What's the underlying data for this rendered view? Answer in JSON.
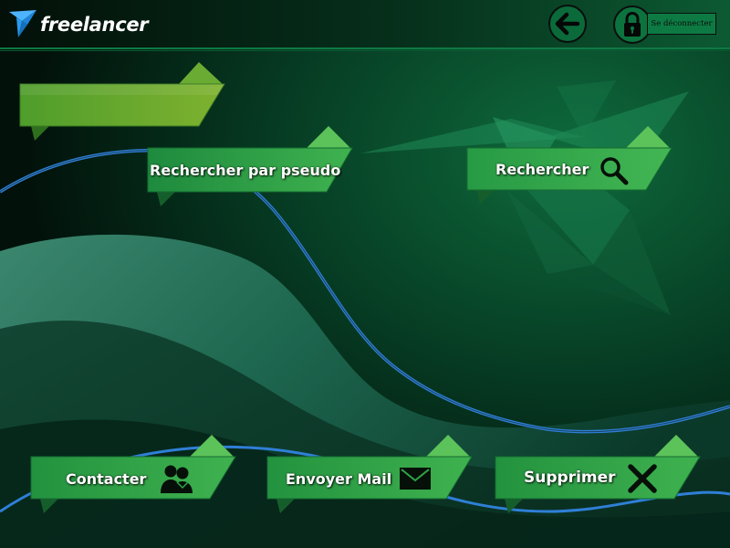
{
  "app": {
    "logo_text": "freelancer"
  },
  "header": {
    "back_icon": "arrow-left-icon",
    "lock_icon": "lock-icon",
    "logout_label": "Se déconnecter"
  },
  "banner": {
    "label": ""
  },
  "actions": {
    "search_pseudo_label": "Rechercher par pseudo",
    "search_label": "Rechercher",
    "search_icon": "magnifier-icon",
    "contact_label": "Contacter",
    "contact_icon": "users-icon",
    "mail_label": "Envoyer Mail",
    "mail_icon": "envelope-icon",
    "delete_label": "Supprimer",
    "delete_icon": "x-icon"
  },
  "colors": {
    "ribbon_green": "#2fa548",
    "ribbon_light": "#5cc35a",
    "banner_green": "#6aa52d",
    "background_dark": "#041a10",
    "wave_blue": "#2f7fd6"
  }
}
